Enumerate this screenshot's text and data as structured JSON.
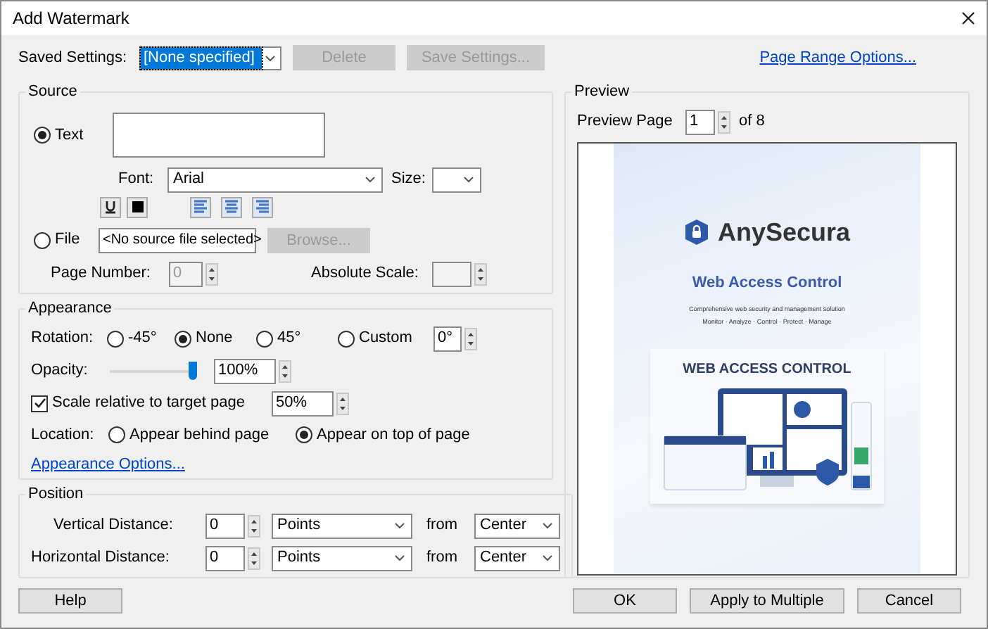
{
  "window": {
    "title": "Add Watermark"
  },
  "saved_settings": {
    "label": "Saved Settings:",
    "value": "[None specified]",
    "buttons": [
      {
        "label": "Delete",
        "disabled": true
      },
      {
        "label": "Save Settings...",
        "disabled": true
      }
    ]
  },
  "page_range_link": "Page Range Options...",
  "source": {
    "title": "Source",
    "options": [
      {
        "label": "Text",
        "selected": true
      },
      {
        "label": "File",
        "selected": false
      }
    ],
    "font_label": "Font:",
    "font_value": "Arial",
    "size_label": "Size:",
    "file_value": "<No source file selected>",
    "browse": {
      "label": "Browse...",
      "disabled": true
    },
    "page_number": {
      "label": "Page Number:",
      "value": "0"
    },
    "absolute_scale": {
      "label": "Absolute Scale:"
    }
  },
  "appearance": {
    "title": "Appearance",
    "rotation_label": "Rotation:",
    "rotations": [
      {
        "label": "-45°",
        "selected": false
      },
      {
        "label": "None",
        "selected": true
      },
      {
        "label": "45°",
        "selected": false
      },
      {
        "label": "Custom",
        "selected": false
      }
    ],
    "rotation_value": "0°",
    "opacity_label": "Opacity:",
    "opacity": {
      "level": 1
    },
    "opacity_value": "100%",
    "scale": {
      "label": "Scale relative to target page",
      "checked": true,
      "value": "50%"
    },
    "location_label": "Location:",
    "locations": [
      {
        "label": "Appear behind page",
        "selected": false
      },
      {
        "label": "Appear on top of page",
        "selected": true
      }
    ],
    "options_link": "Appearance Options..."
  },
  "position": {
    "title": "Position",
    "rows": [
      {
        "label": "Vertical Distance:",
        "value": "0",
        "unit": "Points",
        "from_label": "from",
        "anchor": "Center"
      },
      {
        "label": "Horizontal Distance:",
        "value": "0",
        "unit": "Points",
        "from_label": "from",
        "anchor": "Center"
      }
    ]
  },
  "preview": {
    "title": "Preview",
    "page_label": "Preview Page",
    "page_value": "1",
    "page_total": "of 8",
    "document": {
      "brand": "AnySecura",
      "title": "Web Access Control",
      "subtitle": "Comprehensive web security and management solution",
      "tagline": "Monitor · Analyze · Control · Protect · Manage",
      "banner": "WEB ACCESS CONTROL"
    }
  },
  "footer": {
    "left": {
      "label": "Help"
    },
    "right": [
      {
        "label": "OK"
      },
      {
        "label": "Apply to Multiple"
      },
      {
        "label": "Cancel"
      }
    ]
  }
}
